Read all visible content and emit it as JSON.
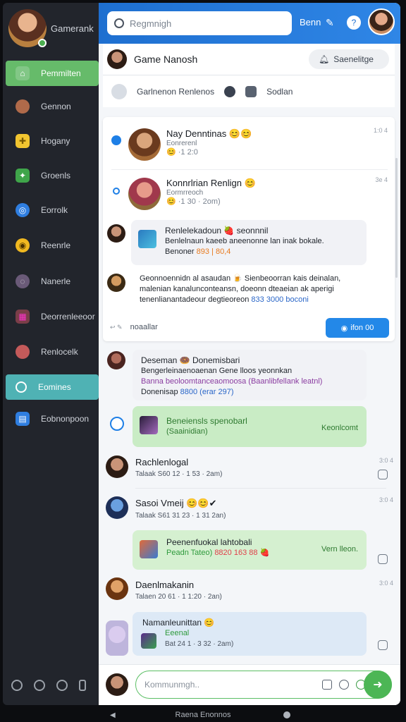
{
  "sidebar": {
    "profile_name": "Gamerank",
    "items": [
      {
        "label": "Pemmilten",
        "icon": "home-icon",
        "color": "#66bb6a"
      },
      {
        "label": "Gennon",
        "icon": "avatar-icon"
      },
      {
        "label": "Hogany",
        "icon": "puzzle-icon"
      },
      {
        "label": "Groenls",
        "icon": "gamepad-icon"
      },
      {
        "label": "Eorrolk",
        "icon": "globe-icon"
      },
      {
        "label": "Reenrle",
        "icon": "target-icon"
      },
      {
        "label": "Nanerle",
        "icon": "chat-icon"
      },
      {
        "label": "Deorrenleeoor",
        "icon": "calendar-icon"
      },
      {
        "label": "Renlocelk",
        "icon": "avatar-icon"
      },
      {
        "label": "Eomines",
        "icon": "clock-icon",
        "color": "#4fb2b4"
      },
      {
        "label": "Eobnonpoon",
        "icon": "book-icon"
      }
    ]
  },
  "topbar": {
    "search_placeholder": "Regmnigh",
    "label": "Benn",
    "accent": "#1e6fd0"
  },
  "header": {
    "title": "Game Nanosh",
    "button": "Saenelitge"
  },
  "subbar": {
    "label1": "Garlnenon Renlenos",
    "label2": "Sodlan"
  },
  "feed": {
    "posts": [
      {
        "title": "Nay Denntinas 😊😊",
        "sub": "Eonrerenl",
        "meta": "😊 ·1 2:0",
        "time": "1:0 4"
      },
      {
        "title": "Konnrlrian Renlign 😊",
        "sub": "Eormrreoch",
        "meta": "😊 ·1 30 · 2om)",
        "time": "3e 4"
      }
    ],
    "bubble1": {
      "title": "Renlelekadoun 🍓 seonnnil",
      "line1": "Benlelnaun kaeeb aneenonne lan inak bokale.",
      "line2": "Benoner",
      "tag": "893 | 80,4"
    },
    "bubble2": {
      "line1": "Geonnoennidn al asaudan 🍺 Sienbeoorran kais deinalan,",
      "line2": "malenian kanalunconteansn, doeonn dteaeian ak aperigi",
      "line3": "tenenlianantadeour degtieoreon",
      "tag": "833 3000 boconi"
    },
    "reply_user": "noaallar",
    "follow_label": "ifon 00"
  },
  "messages": [
    {
      "title": "Deseman 🍩 Donemisbari",
      "line1": "Bengerleinaenoaenan Gene lloos yeonnkan",
      "line2": "Banna beoloomtanceaomoosa (Baanlibfellank leatnl)",
      "line3": "Donenisap",
      "tag": "8800 (erar 297)"
    },
    {
      "title": "Beneiensls spenobarl",
      "sub": "(Saainidian)",
      "right": "Keonlcomt"
    },
    {
      "title": "Rachlenlogal",
      "meta": "Talaak  S60 12 · 1 53 · 2am)",
      "time": "3:0 4"
    },
    {
      "title": "Sasoi Vmeij 😊😊✔",
      "meta": "Talaak  S61 31 23 · 1 31 2an)",
      "time": "3:0 4"
    },
    {
      "title": "Peenenfuokal lahtobali",
      "sub": "Peadn Tateo)",
      "tag": "8820 163 88 🍓",
      "right": "Vern lleon."
    },
    {
      "title": "Daenlmakanin",
      "meta": "Talaen  20 61 · 1 1:20 · 2an)",
      "time": "3:0 4"
    },
    {
      "title": "Namanleunittan 😊",
      "sub": "Eeenal",
      "meta": "Bat 24 1 · 3 32 · 2am)"
    }
  ],
  "composer": {
    "placeholder": "Kommunmgh..",
    "send_icon": "send-icon"
  },
  "system_nav": {
    "label": "Raena Enonnos"
  }
}
